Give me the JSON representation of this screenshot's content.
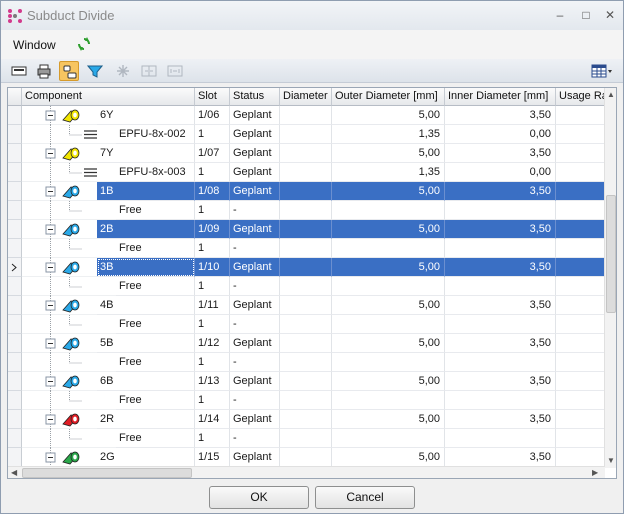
{
  "window": {
    "title": "Subduct Divide",
    "minimize_glyph": "–",
    "maximize_glyph": "□",
    "close_glyph": "✕"
  },
  "menu": {
    "window_label": "Window"
  },
  "toolbar": {
    "icons": [
      "print-preview-icon",
      "print-icon",
      "group-toggle-icon",
      "filter-icon",
      "snowflake-icon",
      "split-icon",
      "merge-icon",
      "column-chooser-icon"
    ]
  },
  "grid": {
    "columns": [
      "Component",
      "Slot",
      "Status",
      "Diameter",
      "Outer Diameter [mm]",
      "Inner Diameter [mm]",
      "Usage Ratio"
    ],
    "rows": [
      {
        "kind": "duct",
        "component": "6Y",
        "slot": "1/06",
        "status": "Geplant",
        "diameter": "",
        "outer": "5,00",
        "inner": "3,50",
        "color": "#f2e600",
        "selected": false
      },
      {
        "kind": "cable",
        "component": "EPFU-8x-002",
        "slot": "1",
        "status": "Geplant",
        "diameter": "",
        "outer": "1,35",
        "inner": "0,00",
        "selected": false
      },
      {
        "kind": "duct",
        "component": "7Y",
        "slot": "1/07",
        "status": "Geplant",
        "diameter": "",
        "outer": "5,00",
        "inner": "3,50",
        "color": "#f2e600",
        "selected": false
      },
      {
        "kind": "cable",
        "component": "EPFU-8x-003",
        "slot": "1",
        "status": "Geplant",
        "diameter": "",
        "outer": "1,35",
        "inner": "0,00",
        "selected": false
      },
      {
        "kind": "duct",
        "component": "1B",
        "slot": "1/08",
        "status": "Geplant",
        "diameter": "",
        "outer": "5,00",
        "inner": "3,50",
        "color": "#2aa9e8",
        "selected": true
      },
      {
        "kind": "free",
        "component": "Free",
        "slot": "1",
        "status": "-",
        "diameter": "",
        "outer": "",
        "inner": "",
        "selected": false
      },
      {
        "kind": "duct",
        "component": "2B",
        "slot": "1/09",
        "status": "Geplant",
        "diameter": "",
        "outer": "5,00",
        "inner": "3,50",
        "color": "#2aa9e8",
        "selected": true
      },
      {
        "kind": "free",
        "component": "Free",
        "slot": "1",
        "status": "-",
        "diameter": "",
        "outer": "",
        "inner": "",
        "selected": false
      },
      {
        "kind": "duct",
        "component": "3B",
        "slot": "1/10",
        "status": "Geplant",
        "diameter": "",
        "outer": "5,00",
        "inner": "3,50",
        "color": "#2aa9e8",
        "selected": true,
        "current": true
      },
      {
        "kind": "free",
        "component": "Free",
        "slot": "1",
        "status": "-",
        "diameter": "",
        "outer": "",
        "inner": "",
        "selected": false
      },
      {
        "kind": "duct",
        "component": "4B",
        "slot": "1/11",
        "status": "Geplant",
        "diameter": "",
        "outer": "5,00",
        "inner": "3,50",
        "color": "#2aa9e8",
        "selected": false
      },
      {
        "kind": "free",
        "component": "Free",
        "slot": "1",
        "status": "-",
        "diameter": "",
        "outer": "",
        "inner": "",
        "selected": false
      },
      {
        "kind": "duct",
        "component": "5B",
        "slot": "1/12",
        "status": "Geplant",
        "diameter": "",
        "outer": "5,00",
        "inner": "3,50",
        "color": "#2aa9e8",
        "selected": false
      },
      {
        "kind": "free",
        "component": "Free",
        "slot": "1",
        "status": "-",
        "diameter": "",
        "outer": "",
        "inner": "",
        "selected": false
      },
      {
        "kind": "duct",
        "component": "6B",
        "slot": "1/13",
        "status": "Geplant",
        "diameter": "",
        "outer": "5,00",
        "inner": "3,50",
        "color": "#2aa9e8",
        "selected": false
      },
      {
        "kind": "free",
        "component": "Free",
        "slot": "1",
        "status": "-",
        "diameter": "",
        "outer": "",
        "inner": "",
        "selected": false
      },
      {
        "kind": "duct",
        "component": "2R",
        "slot": "1/14",
        "status": "Geplant",
        "diameter": "",
        "outer": "5,00",
        "inner": "3,50",
        "color": "#e01c24",
        "selected": false
      },
      {
        "kind": "free",
        "component": "Free",
        "slot": "1",
        "status": "-",
        "diameter": "",
        "outer": "",
        "inner": "",
        "selected": false
      },
      {
        "kind": "duct",
        "component": "2G",
        "slot": "1/15",
        "status": "Geplant",
        "diameter": "",
        "outer": "5,00",
        "inner": "3,50",
        "color": "#2aa84a",
        "selected": false
      }
    ]
  },
  "buttons": {
    "ok": "OK",
    "cancel": "Cancel"
  }
}
